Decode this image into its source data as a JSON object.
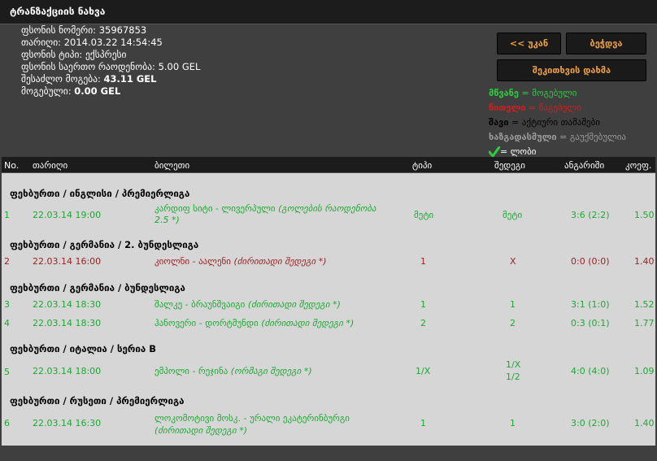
{
  "window": {
    "title": "ტრანზაქციის ნახვა"
  },
  "info": {
    "slip_number_label": "ფსონის ნომერი:",
    "slip_number": "35967853",
    "date_label": "თარიღი:",
    "date": "2014.03.22 14:54:45",
    "type_label": "ფსონის ტიპი:",
    "type": "ექსპრესი",
    "total_stake_label": "ფსონის საერთო რაოდენობა:",
    "total_stake": "5.00 GEL",
    "possible_win_label": "შესაძლო მოგება:",
    "possible_win": "43.11 GEL",
    "won_label": "მოგებული:",
    "won": "0.00 GEL"
  },
  "buttons": {
    "back": "<< უკან",
    "print": "ბეჭდვა",
    "hide": "შეკითხვის დახმა"
  },
  "legend": {
    "green_key": "მწვანე",
    "green_val": "= მოგებული",
    "red_key": "წითელი",
    "red_val": "= წაგებული",
    "black_key": "შავი",
    "black_val": "= აქტიური თამაშები",
    "gray_key": "ხაზგადასმული",
    "gray_val": "= გაუქმებულია",
    "tick_val": "= ლობი"
  },
  "table": {
    "headers": {
      "no": "No.",
      "date": "თარიღი",
      "ticket": "ბილეთი",
      "type": "ტიპი",
      "result": "შედეგი",
      "score": "ანგარიში",
      "coef": "კოეფ."
    },
    "groups": [
      {
        "title": "ფეხბურთი / ინგლისი / პრემიერლიგა"
      },
      {
        "title": "ფეხბურთი / გერმანია / 2. ბუნდესლიგა"
      },
      {
        "title": "ფეხბურთი / გერმანია / ბუნდესლიგა"
      },
      {
        "title": "ფეხბურთი / იტალია / სერია B"
      },
      {
        "title": "ფეხბურთი / რუსეთი / პრემიერლიგა"
      }
    ],
    "rows": [
      {
        "no": "1",
        "date": "22.03.14 19:00",
        "ticket_a": "კარდიფ სიტი - ლივერპული",
        "ticket_b": "(გოლების რაოდენობა",
        "ticket_c": "2.5 *)",
        "type": "მეტი",
        "result": "მეტი",
        "result_b": "",
        "score": "3:6 (2:2)",
        "coef": "1.50",
        "status": "won"
      },
      {
        "no": "2",
        "date": "22.03.14 16:00",
        "ticket_a": "კიოლნი - აალენი",
        "ticket_b": "(ძირითადი შედეგი *)",
        "ticket_c": "",
        "type": "1",
        "result": "X",
        "result_b": "",
        "score": "0:0 (0:0)",
        "coef": "1.40",
        "status": "lost"
      },
      {
        "no": "3",
        "date": "22.03.14 18:30",
        "ticket_a": "შალკე - ბრაუნშვაიგი",
        "ticket_b": "(ძირითადი შედეგი *)",
        "ticket_c": "",
        "type": "1",
        "result": "1",
        "result_b": "",
        "score": "3:1 (1:0)",
        "coef": "1.52",
        "status": "won"
      },
      {
        "no": "4",
        "date": "22.03.14 18:30",
        "ticket_a": "ჰანოვერი - დორტმუნდი",
        "ticket_b": "(ძირითადი შედეგი *)",
        "ticket_c": "",
        "type": "2",
        "result": "2",
        "result_b": "",
        "score": "0:3 (0:1)",
        "coef": "1.77",
        "status": "won"
      },
      {
        "no": "5",
        "date": "22.03.14 18:00",
        "ticket_a": "ემპოლი - რეჯინა",
        "ticket_b": "(ორმაგი შედეგი *)",
        "ticket_c": "",
        "type": "1/X",
        "result": "1/X",
        "result_b": "1/2",
        "score": "4:0 (4:0)",
        "coef": "1.09",
        "status": "won"
      },
      {
        "no": "6",
        "date": "22.03.14 16:30",
        "ticket_a": "ლოკომოტივი მოსკ. - ურალი ეკატერინბურგი",
        "ticket_b": "(ძირითადი შედეგი *)",
        "ticket_c": "",
        "type": "1",
        "result": "1",
        "result_b": "",
        "score": "3:0 (2:0)",
        "coef": "1.40",
        "status": "won"
      }
    ]
  }
}
